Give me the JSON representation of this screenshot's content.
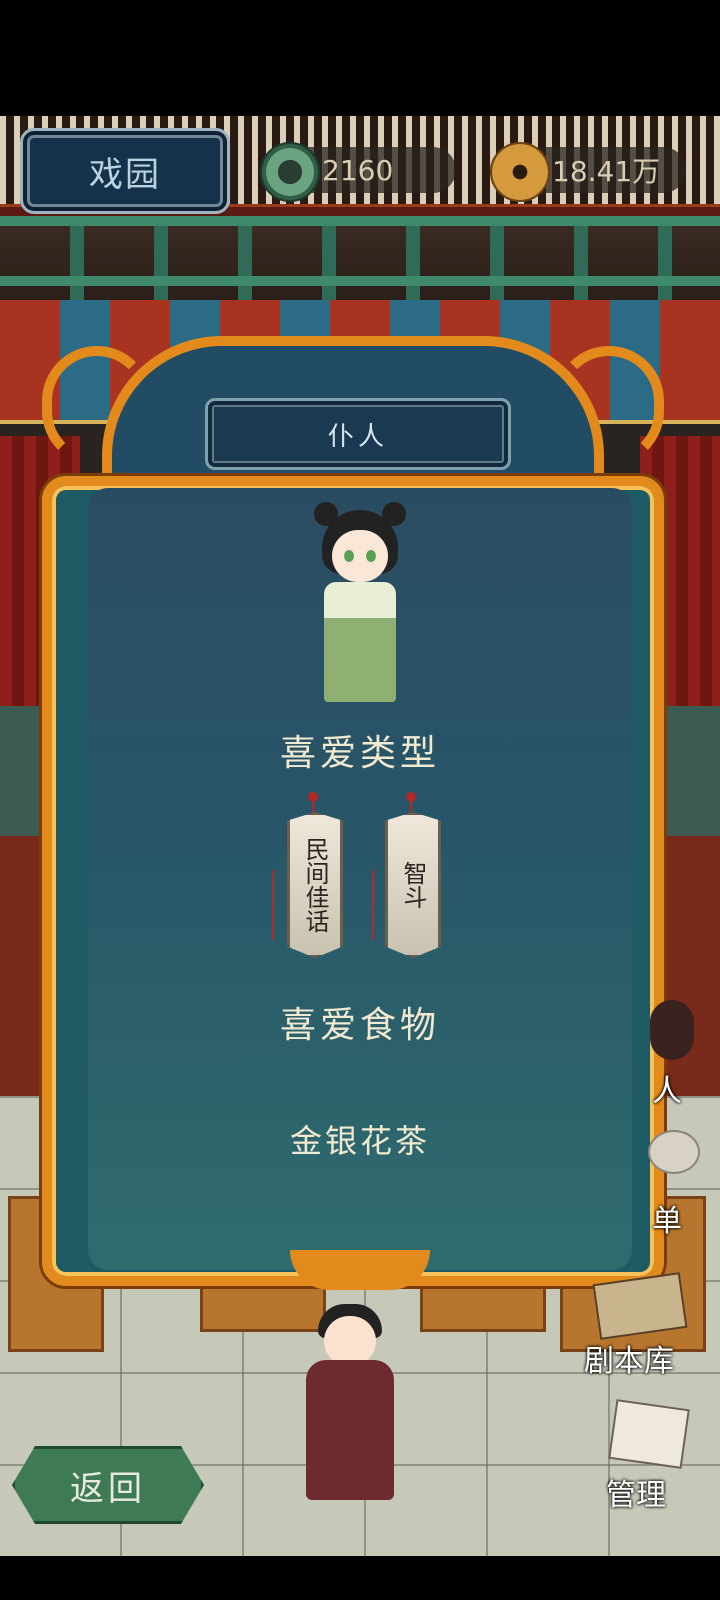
{
  "header": {
    "title": "戏园",
    "jade_amount": "2160",
    "coin_amount": "18.41万"
  },
  "dialog": {
    "title": "仆人",
    "favorite_type_heading": "喜爱类型",
    "tags": [
      "民间佳话",
      "智斗"
    ],
    "favorite_food_heading": "喜爱食物",
    "favorite_food": "金银花茶"
  },
  "side_menu": {
    "partial_top": "人",
    "partial_middle": "单",
    "script_library": "剧本库",
    "management": "管理"
  },
  "footer": {
    "back_label": "返回"
  },
  "icons": [
    "jade-coin-icon",
    "copper-coin-icon",
    "script-cards-icon",
    "brush-scroll-icon"
  ],
  "colors": {
    "frame_orange": "#e38a1c",
    "panel_teal": "#285668",
    "title_navy": "#16324a",
    "back_green": "#3e7a54"
  }
}
